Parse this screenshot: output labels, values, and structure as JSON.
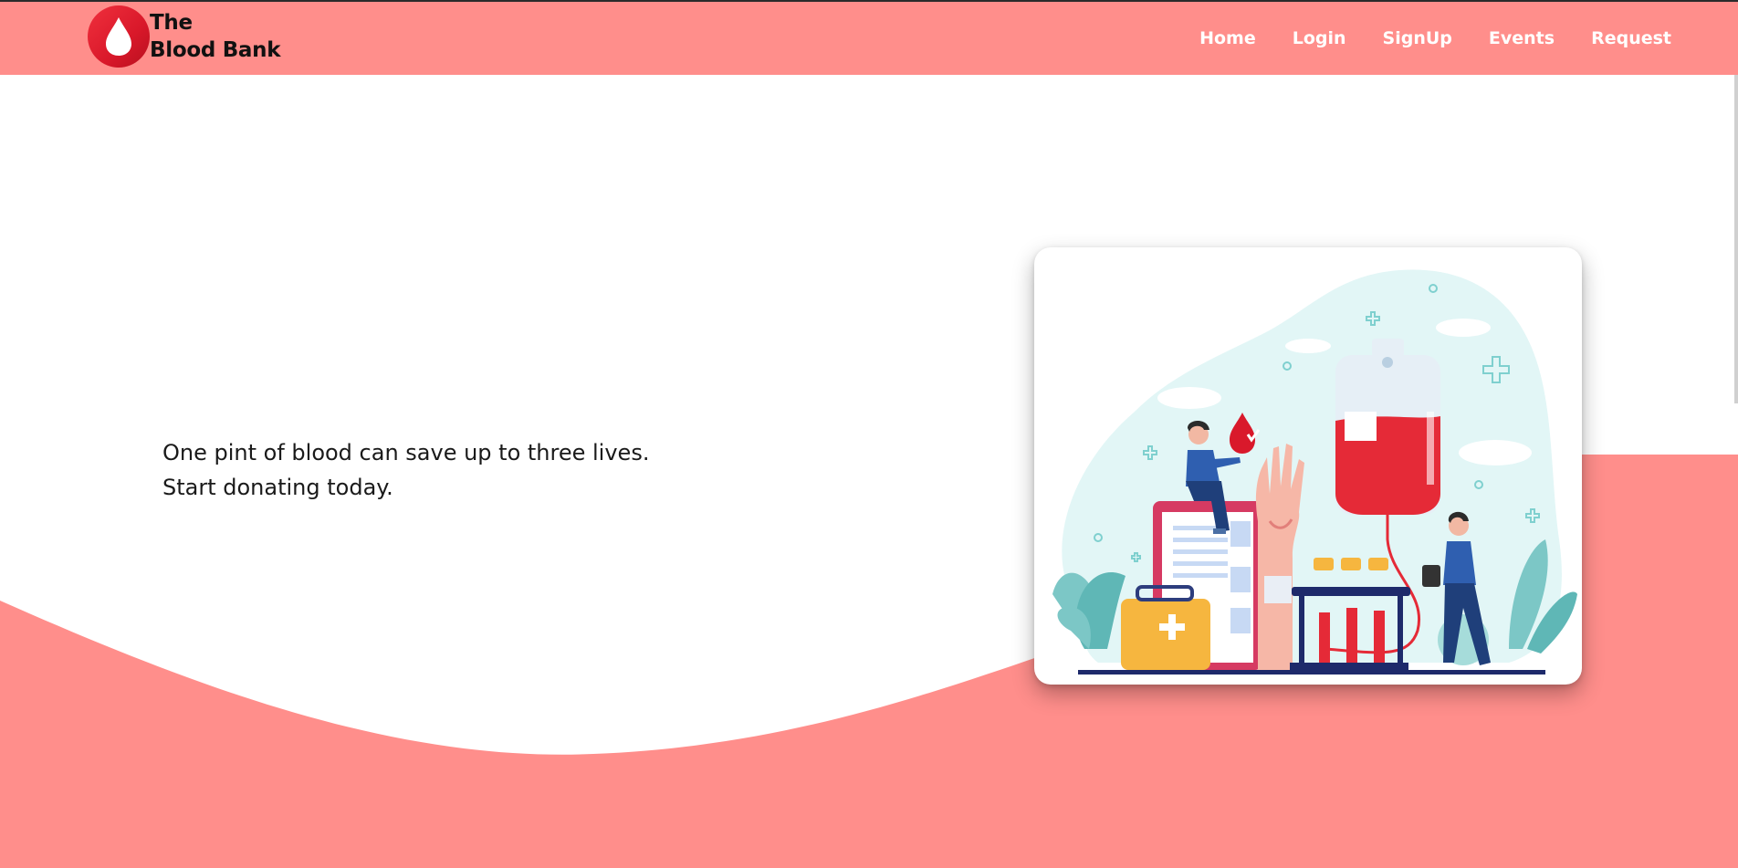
{
  "brand": {
    "line1": "The",
    "line2": "Blood Bank",
    "logo_icon": "blood-drop-icon"
  },
  "nav": {
    "items": [
      {
        "label": "Home"
      },
      {
        "label": "Login"
      },
      {
        "label": "SignUp"
      },
      {
        "label": "Events"
      },
      {
        "label": "Request"
      }
    ]
  },
  "hero": {
    "line1": "One pint of blood can save up to three lives.",
    "line2": "Start donating today."
  },
  "colors": {
    "accent": "#ff8e8b",
    "brand_red": "#e01e2d",
    "text": "#1a1a1a"
  }
}
